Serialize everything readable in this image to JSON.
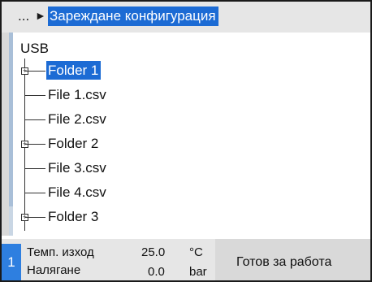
{
  "header": {
    "ellipsis": "...",
    "arrow_glyph": "►",
    "title": "Зареждане конфигурация"
  },
  "tree": {
    "root_label": "USB",
    "items": [
      {
        "label": "Folder 1",
        "type": "folder",
        "selected": true
      },
      {
        "label": "File 1.csv",
        "type": "file",
        "selected": false
      },
      {
        "label": "File 2.csv",
        "type": "file",
        "selected": false
      },
      {
        "label": "Folder 2",
        "type": "folder",
        "selected": false
      },
      {
        "label": "File 3.csv",
        "type": "file",
        "selected": false
      },
      {
        "label": "File 4.csv",
        "type": "file",
        "selected": false
      },
      {
        "label": "Folder 3",
        "type": "folder",
        "selected": false
      }
    ]
  },
  "footer": {
    "badge": "1",
    "readings": [
      {
        "label": "Темп. изход",
        "value": "25.0",
        "unit": "°C"
      },
      {
        "label": "Налягане",
        "value": "0.0",
        "unit": "bar"
      }
    ],
    "status": "Готов за работа"
  },
  "colors": {
    "accent": "#1c6bd4",
    "badge": "#2e7fe0",
    "panel": "#e6e6e6"
  }
}
